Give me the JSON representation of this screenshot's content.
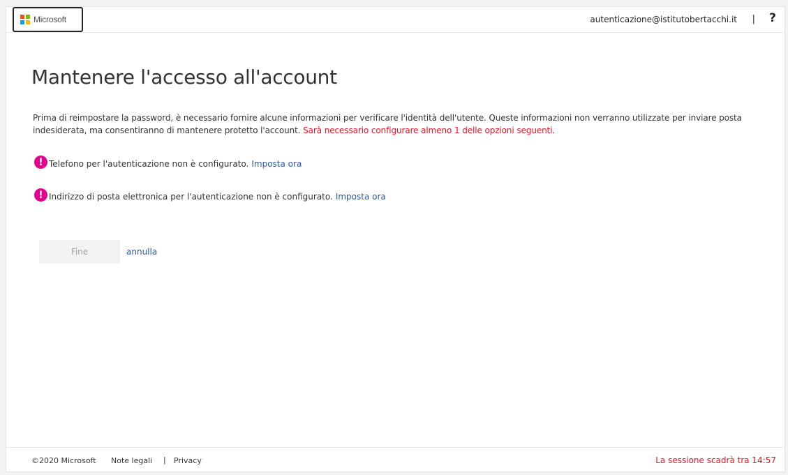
{
  "header": {
    "logo_text": "Microsoft",
    "logo_colors": [
      "#f25022",
      "#7fba00",
      "#00a4ef",
      "#ffb900"
    ],
    "account": "autenticazione@istitutobertacchi.it",
    "separator": "|",
    "help": "?"
  },
  "main": {
    "title": "Mantenere l'accesso all'account",
    "intro": "Prima di reimpostare la password, è necessario fornire alcune informazioni per verificare l'identità dell'utente. Queste informazioni non verranno utilizzate per inviare posta indesiderata, ma consentiranno di mantenere protetto l'account.",
    "intro_warning": "Sarà necessario configurare almeno 1 delle opzioni seguenti.",
    "items": [
      {
        "icon": "alert-icon",
        "text": "Telefono per l'autenticazione non è configurato.",
        "link": "Imposta ora"
      },
      {
        "icon": "alert-icon",
        "text": "Indirizzo di posta elettronica per l'autenticazione non è configurato.",
        "link": "Imposta ora"
      }
    ],
    "finish_label": "Fine",
    "cancel_label": "annulla"
  },
  "footer": {
    "copyright": "©2020 Microsoft",
    "legal": "Note legali",
    "separator": "|",
    "privacy": "Privacy",
    "session": "La sessione scadrà tra 14:57"
  },
  "colors": {
    "accent_link": "#2b57a6",
    "warning": "#e81123",
    "alert_icon": "#e3008c"
  }
}
